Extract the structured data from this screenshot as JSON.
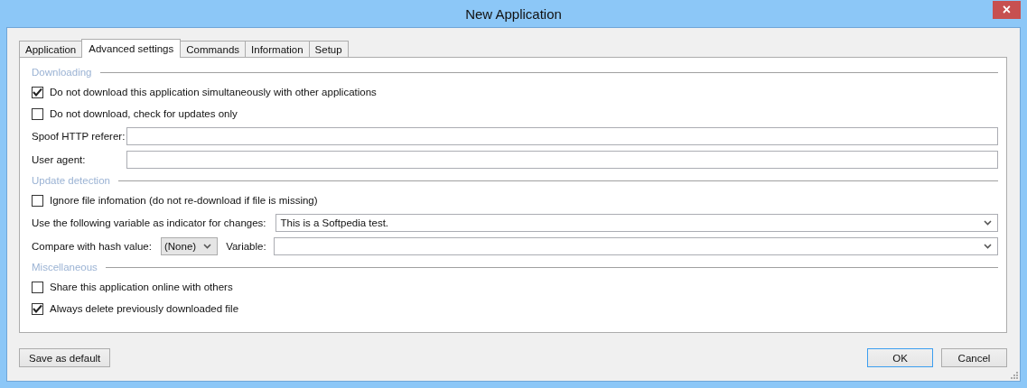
{
  "window": {
    "title": "New Application",
    "close": "×"
  },
  "tabs": [
    {
      "label": "Application",
      "selected": false
    },
    {
      "label": "Advanced settings",
      "selected": true
    },
    {
      "label": "Commands",
      "selected": false
    },
    {
      "label": "Information",
      "selected": false
    },
    {
      "label": "Setup",
      "selected": false
    }
  ],
  "sections": [
    {
      "title": "Downloading",
      "rows": [
        {
          "kind": "checkbox",
          "label": "Do not download this application simultaneously with other applications",
          "checked": true
        },
        {
          "kind": "checkbox",
          "label": "Do not download, check for updates only",
          "checked": false
        },
        {
          "kind": "field",
          "label": "Spoof HTTP referer:"
        },
        {
          "kind": "field",
          "label": "User agent:"
        }
      ]
    },
    {
      "title": "Update detection",
      "rows": [
        {
          "kind": "checkbox",
          "label": "Ignore file infomation (do not re-download if file is missing)",
          "checked": false
        },
        {
          "kind": "dropdown",
          "label": "Use the following variable as indicator for changes:",
          "value": "This is a Softpedia test."
        },
        {
          "kind": "hash",
          "label": "Compare with hash value:",
          "value": "(None)",
          "label_2": "Variable:"
        }
      ]
    },
    {
      "title": "Miscellaneous",
      "rows": [
        {
          "kind": "checkbox",
          "label": "Share this application online with others",
          "checked": false
        },
        {
          "kind": "checkbox",
          "label": "Always delete previously downloaded file",
          "checked": true
        }
      ]
    }
  ],
  "buttons": {
    "save_default": "Save as default",
    "ok": "OK",
    "cancel": "Cancel"
  }
}
